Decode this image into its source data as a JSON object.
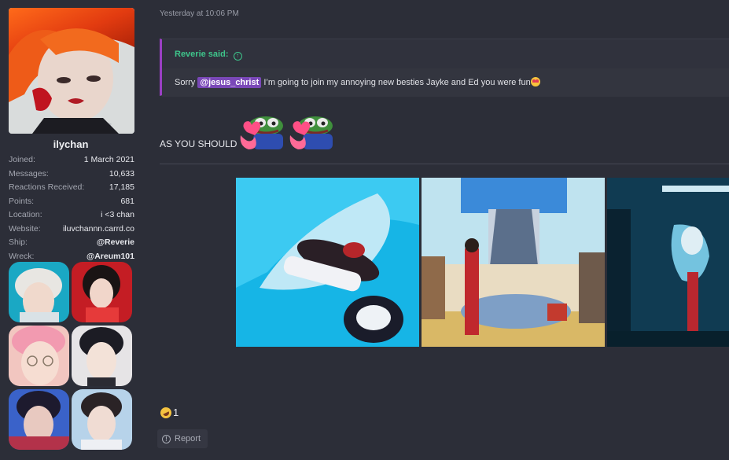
{
  "user": {
    "name": "ilychan",
    "stats": [
      {
        "key": "Joined:",
        "value": "1 March 2021"
      },
      {
        "key": "Messages:",
        "value": "10,633"
      },
      {
        "key": "Reactions Received:",
        "value": "17,185"
      },
      {
        "key": "Points:",
        "value": "681"
      },
      {
        "key": "Location:",
        "value": "i <3 chan"
      },
      {
        "key": "Website:",
        "value": "iluvchannn.carrd.co"
      },
      {
        "key": "Ship:",
        "value": "@Reverie"
      },
      {
        "key": "Wreck:",
        "value": "@Areum101"
      }
    ]
  },
  "post": {
    "timestamp": "Yesterday at 10:06 PM",
    "quote": {
      "author_line": "Reverie said:",
      "arrow_icon": "↑",
      "prefix": "Sorry ",
      "mention": "@jesus_christ",
      "text": " I’m going to join my annoying new besties Jayke and Ed you were fun"
    },
    "reply_text": "AS YOU SHOULD",
    "reaction_count": "1",
    "report_label": "Report",
    "report_icon": "!"
  },
  "colors": {
    "background": "#2c2e38",
    "quote_border": "#9b3fc4",
    "quote_author": "#3ec58b",
    "mention_bg": "#7a48b8"
  },
  "icons": {
    "reaction": "rofl-emoji-icon",
    "quote_emoji": "heart-eyes-emoji-icon",
    "sticker": "pepe-heart-icon"
  }
}
